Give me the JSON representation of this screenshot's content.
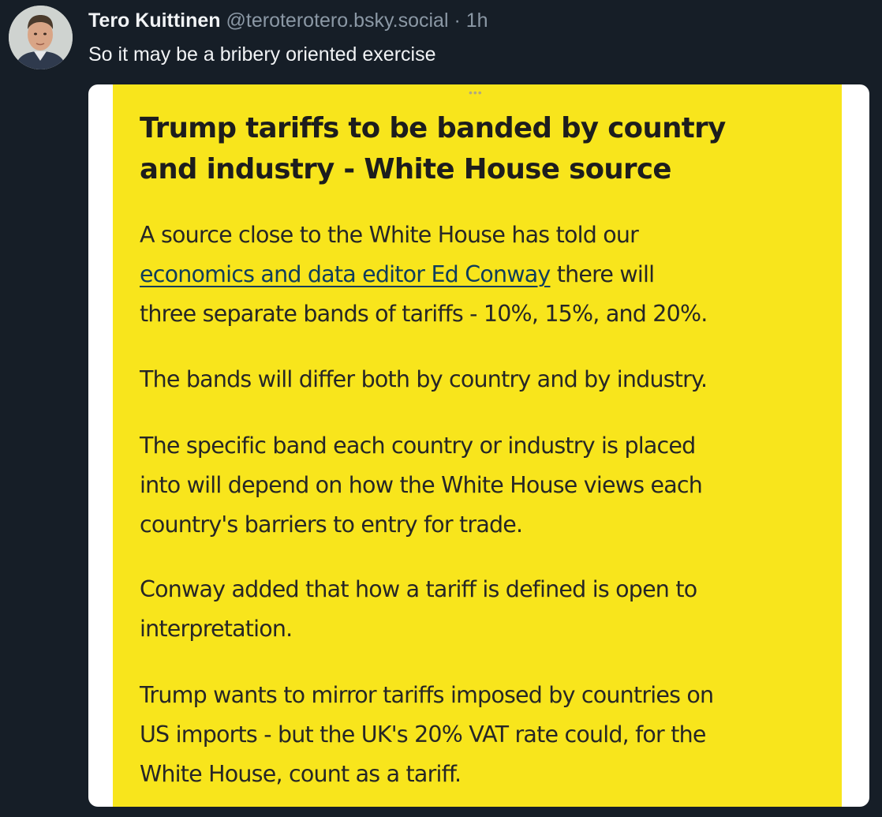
{
  "post": {
    "author_name": "Tero Kuittinen",
    "author_handle": "@teroterotero.bsky.social",
    "separator": "·",
    "time": "1h",
    "text": "So it may be a bribery oriented exercise"
  },
  "embed": {
    "dots": "•••",
    "title_line1": "Trump tariffs to be banded by country",
    "title_line2": "and industry - White House source",
    "p1_line1": "A source close to the White House has told our",
    "p1_link": "economics and data editor Ed Conway",
    "p1_after_link": " there will",
    "p1_line3": "three separate bands of tariffs - 10%, 15%, and 20%.",
    "p2": "The bands will differ both by country and by industry.",
    "p3_line1": "The specific band each country or industry is placed",
    "p3_line2": "into will depend on how the White House views each",
    "p3_line3": "country's barriers to entry for trade.",
    "p4_line1": "Conway added that how a tariff is defined is open to",
    "p4_line2": "interpretation.",
    "p5_line1": "Trump wants to mirror tariffs imposed by countries on",
    "p5_line2": "US imports - but the UK's 20% VAT rate could, for the",
    "p5_line3": "White House, count as a tariff."
  },
  "colors": {
    "background": "#161e27",
    "panel_yellow": "#f8e51c",
    "link": "#0f3d5c",
    "handle_gray": "#8b98a5"
  }
}
